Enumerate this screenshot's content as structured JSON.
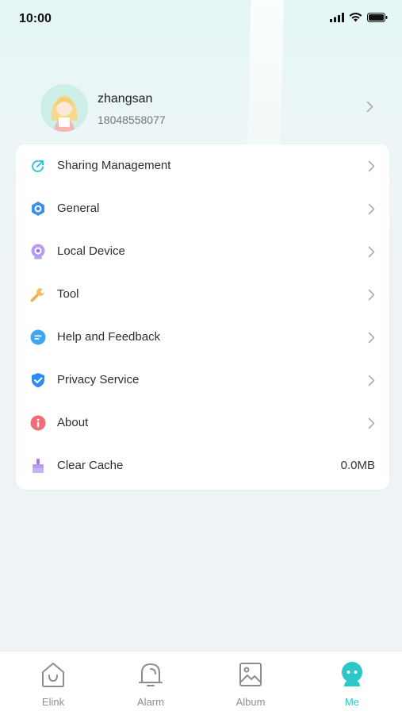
{
  "status_bar": {
    "time": "10:00"
  },
  "profile": {
    "username": "zhangsan",
    "phone": "18048558077"
  },
  "menu": [
    {
      "label": "Sharing Management",
      "icon": "share-icon"
    },
    {
      "label": "General",
      "icon": "settings-hexagon-icon"
    },
    {
      "label": "Local Device",
      "icon": "camera-icon"
    },
    {
      "label": "Tool",
      "icon": "wrench-icon"
    },
    {
      "label": "Help and Feedback",
      "icon": "chat-icon"
    },
    {
      "label": "Privacy Service",
      "icon": "shield-check-icon"
    },
    {
      "label": "About",
      "icon": "info-icon"
    },
    {
      "label": "Clear Cache",
      "icon": "broom-icon",
      "value": "0.0MB"
    }
  ],
  "tabs": [
    {
      "label": "Elink",
      "icon": "home-icon"
    },
    {
      "label": "Alarm",
      "icon": "bell-icon"
    },
    {
      "label": "Album",
      "icon": "image-icon"
    },
    {
      "label": "Me",
      "icon": "robot-face-icon",
      "active": true
    }
  ],
  "colors": {
    "accent": "#2ec7c9",
    "background": "#eef3f6"
  }
}
